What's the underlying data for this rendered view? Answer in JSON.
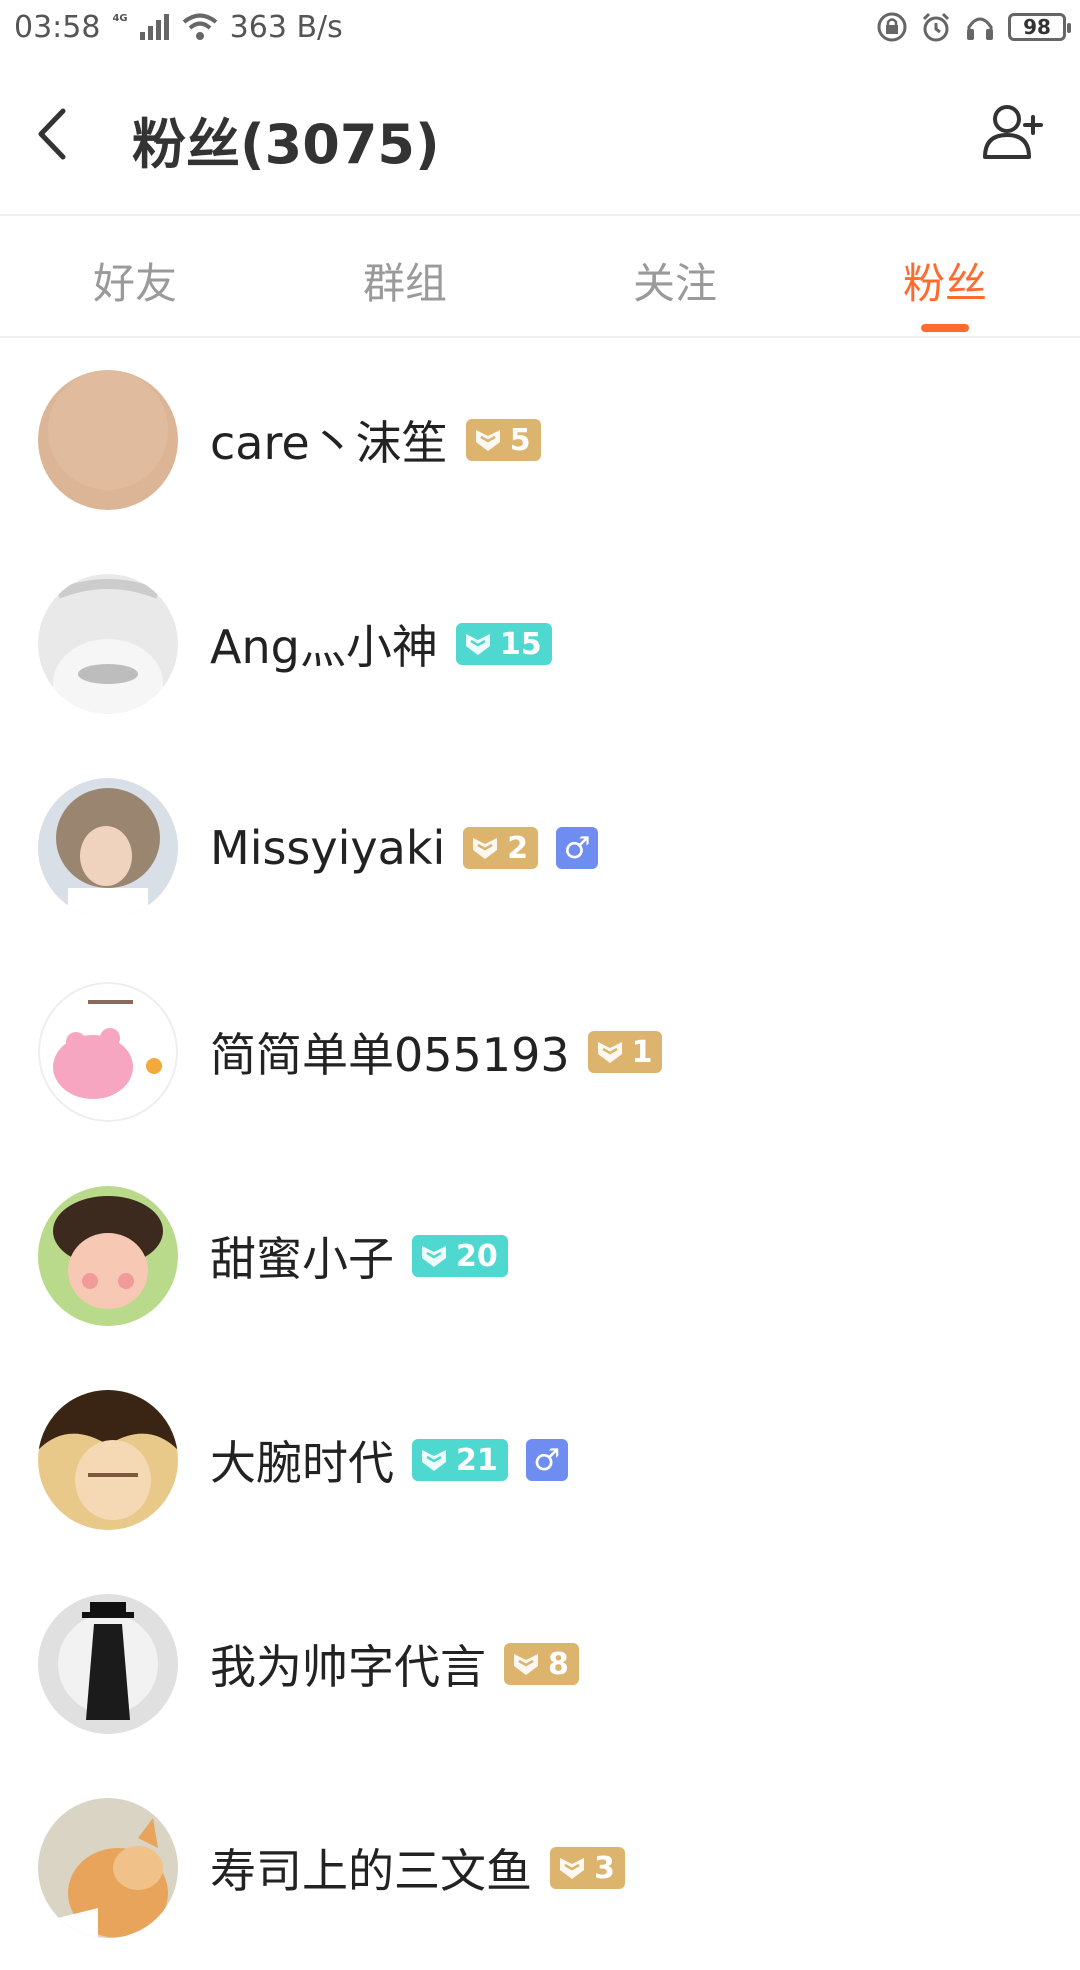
{
  "status_bar": {
    "time": "03:58",
    "network_type": "4G",
    "speed": "363 B/s",
    "battery": "98",
    "icons": [
      "signal-icon",
      "wifi-icon",
      "lock-rotation-icon",
      "alarm-icon",
      "headphones-icon",
      "battery-icon"
    ]
  },
  "header": {
    "title": "粉丝(3075)",
    "back_icon": "back-arrow-icon",
    "add_icon": "add-user-icon"
  },
  "tabs": [
    {
      "label": "好友",
      "active": false
    },
    {
      "label": "群组",
      "active": false
    },
    {
      "label": "关注",
      "active": false
    },
    {
      "label": "粉丝",
      "active": true
    }
  ],
  "colors": {
    "accent": "#ff6b2e",
    "badge_gold": "#dcb46e",
    "badge_teal": "#4fd8d0",
    "gender_male": "#6f8cf0"
  },
  "fans": [
    {
      "name": "care丶沫笙",
      "level": "5",
      "badge_style": "gold",
      "gender": ""
    },
    {
      "name": "Ang灬小神",
      "level": "15",
      "badge_style": "teal",
      "gender": ""
    },
    {
      "name": "Missyiyaki",
      "level": "2",
      "badge_style": "gold",
      "gender": "♂"
    },
    {
      "name": "简简单单055193",
      "level": "1",
      "badge_style": "gold",
      "gender": ""
    },
    {
      "name": "甜蜜小子",
      "level": "20",
      "badge_style": "teal",
      "gender": ""
    },
    {
      "name": "大腕时代",
      "level": "21",
      "badge_style": "teal",
      "gender": "♂"
    },
    {
      "name": "我为帅字代言",
      "level": "8",
      "badge_style": "gold",
      "gender": ""
    },
    {
      "name": "寿司上的三文鱼",
      "level": "3",
      "badge_style": "gold",
      "gender": ""
    }
  ]
}
